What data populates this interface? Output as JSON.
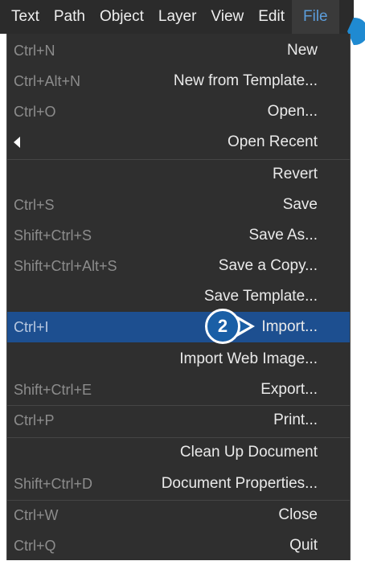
{
  "menubar": {
    "items": [
      "Text",
      "Path",
      "Object",
      "Layer",
      "View",
      "Edit",
      "File"
    ],
    "active": "File"
  },
  "file_menu": {
    "items": [
      {
        "shortcut": "Ctrl+N",
        "label": "New"
      },
      {
        "shortcut": "Ctrl+Alt+N",
        "label": "New from Template..."
      },
      {
        "shortcut": "Ctrl+O",
        "label": "Open..."
      },
      {
        "shortcut": "",
        "label": "Open Recent",
        "submenu_icon": "left-triangle-icon"
      },
      {
        "shortcut": "",
        "label": "Revert"
      },
      {
        "shortcut": "Ctrl+S",
        "label": "Save"
      },
      {
        "shortcut": "Shift+Ctrl+S",
        "label": "Save As..."
      },
      {
        "shortcut": "Shift+Ctrl+Alt+S",
        "label": "Save a Copy..."
      },
      {
        "shortcut": "",
        "label": "Save Template..."
      },
      {
        "shortcut": "Ctrl+I",
        "label": "Import...",
        "highlighted": true
      },
      {
        "shortcut": "",
        "label": "Import Web Image..."
      },
      {
        "shortcut": "Shift+Ctrl+E",
        "label": "Export..."
      },
      {
        "shortcut": "Ctrl+P",
        "label": "Print..."
      },
      {
        "shortcut": "",
        "label": "Clean Up Document"
      },
      {
        "shortcut": "Shift+Ctrl+D",
        "label": "Document Properties..."
      },
      {
        "shortcut": "Ctrl+W",
        "label": "Close"
      },
      {
        "shortcut": "Ctrl+Q",
        "label": "Quit"
      }
    ]
  },
  "step_badge": {
    "number": "2"
  },
  "colors": {
    "menu_bg": "#2f2f2f",
    "highlight": "#1d4f90",
    "active_menu_text": "#5c9ddb",
    "badge": "#1a5fa6"
  }
}
